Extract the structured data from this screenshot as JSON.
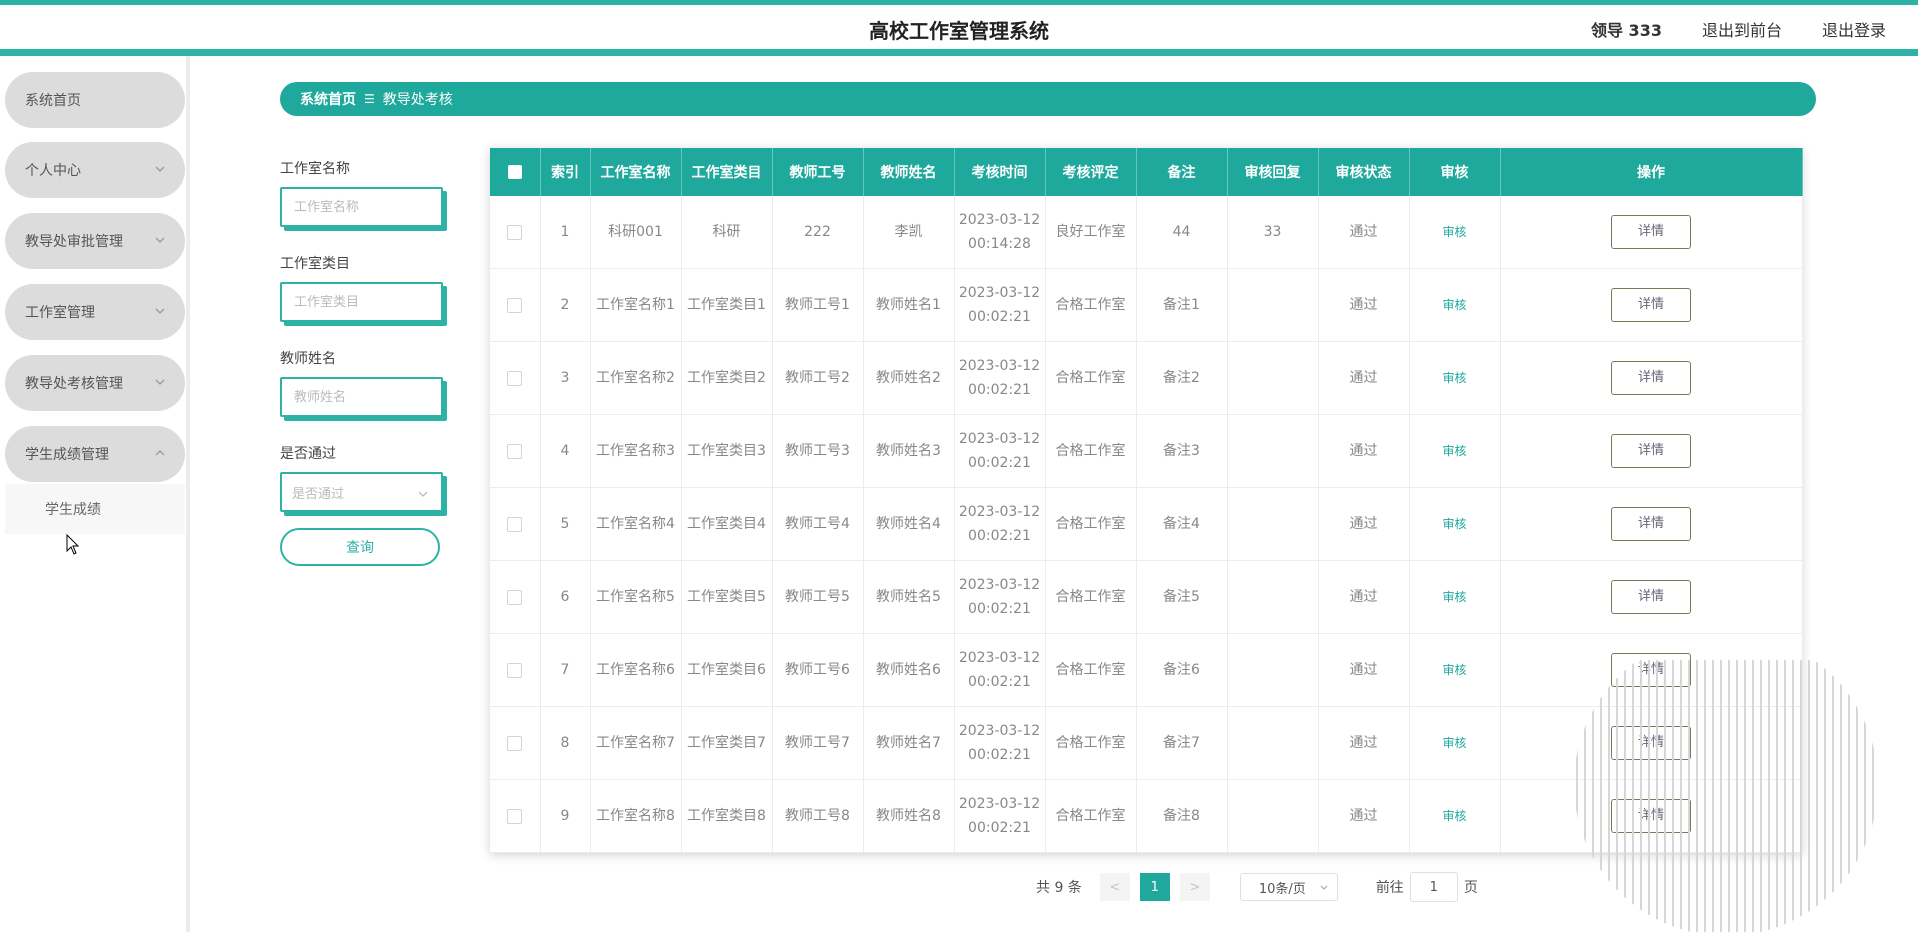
{
  "header": {
    "title": "高校工作室管理系统",
    "user": "领导 333",
    "to_front": "退出到前台",
    "logout": "退出登录"
  },
  "sidebar": {
    "items": [
      {
        "label": "系统首页"
      },
      {
        "label": "个人中心"
      },
      {
        "label": "教导处审批管理"
      },
      {
        "label": "工作室管理"
      },
      {
        "label": "教导处考核管理"
      },
      {
        "label": "学生成绩管理"
      }
    ],
    "sub_item": "学生成绩"
  },
  "breadcrumb": {
    "home": "系统首页",
    "separator": "☰",
    "current": "教导处考核"
  },
  "search": {
    "studio_name_label": "工作室名称",
    "studio_name_placeholder": "工作室名称",
    "studio_category_label": "工作室类目",
    "studio_category_placeholder": "工作室类目",
    "teacher_name_label": "教师姓名",
    "teacher_name_placeholder": "教师姓名",
    "passed_label": "是否通过",
    "passed_placeholder": "是否通过",
    "query_button": "查询"
  },
  "table": {
    "headers": [
      "索引",
      "工作室名称",
      "工作室类目",
      "教师工号",
      "教师姓名",
      "考核时间",
      "考核评定",
      "备注",
      "审核回复",
      "审核状态",
      "审核",
      "操作"
    ],
    "audit_label": "审核",
    "detail_label": "详情",
    "rows": [
      {
        "index": "1",
        "studio_name": "科研001",
        "category": "科研",
        "teacher_no": "222",
        "teacher_name": "李凯",
        "time": "2023-03-12 00:14:28",
        "rating": "良好工作室",
        "remark": "44",
        "reply": "33",
        "status": "通过"
      },
      {
        "index": "2",
        "studio_name": "工作室名称1",
        "category": "工作室类目1",
        "teacher_no": "教师工号1",
        "teacher_name": "教师姓名1",
        "time": "2023-03-12 00:02:21",
        "rating": "合格工作室",
        "remark": "备注1",
        "reply": "",
        "status": "通过"
      },
      {
        "index": "3",
        "studio_name": "工作室名称2",
        "category": "工作室类目2",
        "teacher_no": "教师工号2",
        "teacher_name": "教师姓名2",
        "time": "2023-03-12 00:02:21",
        "rating": "合格工作室",
        "remark": "备注2",
        "reply": "",
        "status": "通过"
      },
      {
        "index": "4",
        "studio_name": "工作室名称3",
        "category": "工作室类目3",
        "teacher_no": "教师工号3",
        "teacher_name": "教师姓名3",
        "time": "2023-03-12 00:02:21",
        "rating": "合格工作室",
        "remark": "备注3",
        "reply": "",
        "status": "通过"
      },
      {
        "index": "5",
        "studio_name": "工作室名称4",
        "category": "工作室类目4",
        "teacher_no": "教师工号4",
        "teacher_name": "教师姓名4",
        "time": "2023-03-12 00:02:21",
        "rating": "合格工作室",
        "remark": "备注4",
        "reply": "",
        "status": "通过"
      },
      {
        "index": "6",
        "studio_name": "工作室名称5",
        "category": "工作室类目5",
        "teacher_no": "教师工号5",
        "teacher_name": "教师姓名5",
        "time": "2023-03-12 00:02:21",
        "rating": "合格工作室",
        "remark": "备注5",
        "reply": "",
        "status": "通过"
      },
      {
        "index": "7",
        "studio_name": "工作室名称6",
        "category": "工作室类目6",
        "teacher_no": "教师工号6",
        "teacher_name": "教师姓名6",
        "time": "2023-03-12 00:02:21",
        "rating": "合格工作室",
        "remark": "备注6",
        "reply": "",
        "status": "通过"
      },
      {
        "index": "8",
        "studio_name": "工作室名称7",
        "category": "工作室类目7",
        "teacher_no": "教师工号7",
        "teacher_name": "教师姓名7",
        "time": "2023-03-12 00:02:21",
        "rating": "合格工作室",
        "remark": "备注7",
        "reply": "",
        "status": "通过"
      },
      {
        "index": "9",
        "studio_name": "工作室名称8",
        "category": "工作室类目8",
        "teacher_no": "教师工号8",
        "teacher_name": "教师姓名8",
        "time": "2023-03-12 00:02:21",
        "rating": "合格工作室",
        "remark": "备注8",
        "reply": "",
        "status": "通过"
      }
    ]
  },
  "pagination": {
    "total": "共 9 条",
    "prev": "<",
    "current_page": "1",
    "next": ">",
    "page_size": "10条/页",
    "goto_label": "前往",
    "goto_value": "1",
    "page_suffix": "页"
  },
  "colors": {
    "accent": "#1fa89c",
    "accent_light": "#2fb2a6",
    "menu_bg": "#dcdcdc"
  }
}
